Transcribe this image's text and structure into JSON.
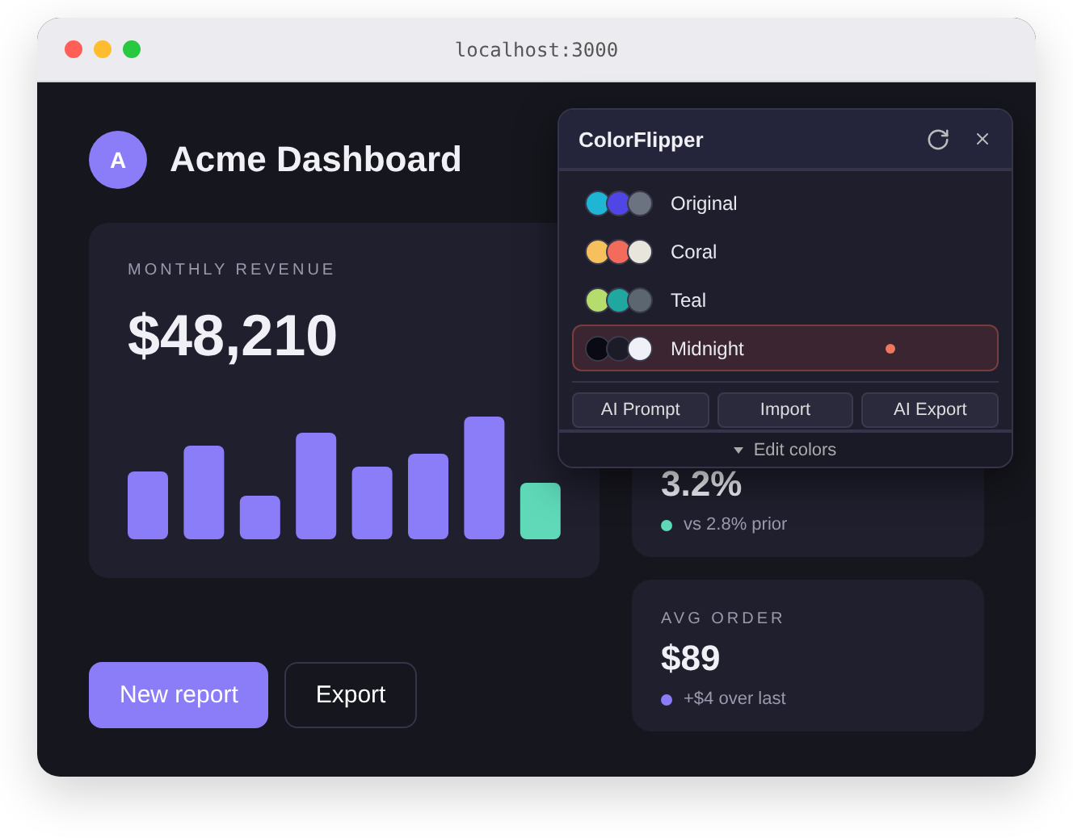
{
  "browser": {
    "url": "localhost:3000"
  },
  "header": {
    "avatar": "A",
    "title": "Acme Dashboard"
  },
  "revenue": {
    "label": "MONTHLY REVENUE",
    "value": "$48,210"
  },
  "buttons": [
    {
      "label": "New report",
      "kind": "primary"
    },
    {
      "label": "Export",
      "kind": "secondary"
    }
  ],
  "stats": [
    {
      "value": "3.2%",
      "note": "vs 2.8% prior",
      "color": "#5fd9b8"
    },
    {
      "label": "AVG ORDER",
      "value": "$89",
      "note": "+$4 over last",
      "color": "#8b7cf8"
    }
  ],
  "popup": {
    "title": "ColorFlipper",
    "presets": [
      {
        "name": "Original",
        "selected": false,
        "swatches": [
          {
            "color": "#1fb6d6"
          },
          {
            "color": "#5046e5"
          },
          {
            "color": "#6b7280"
          }
        ]
      },
      {
        "name": "Coral",
        "selected": false,
        "swatches": [
          {
            "color": "#f6c15c"
          },
          {
            "color": "#f26b5b"
          },
          {
            "color": "#e8e6dc"
          }
        ]
      },
      {
        "name": "Teal",
        "selected": false,
        "swatches": [
          {
            "color": "#b5dd6e"
          },
          {
            "color": "#1fa7a0"
          },
          {
            "color": "#5c6670"
          }
        ]
      },
      {
        "name": "Midnight",
        "selected": true,
        "swatches": [
          {
            "color": "#0a0a14"
          },
          {
            "color": "#1c1c28"
          },
          {
            "color": "#f0f0f8"
          }
        ]
      }
    ],
    "actions": [
      "AI Prompt",
      "Import",
      "AI Export"
    ],
    "footer": "Edit colors"
  }
}
